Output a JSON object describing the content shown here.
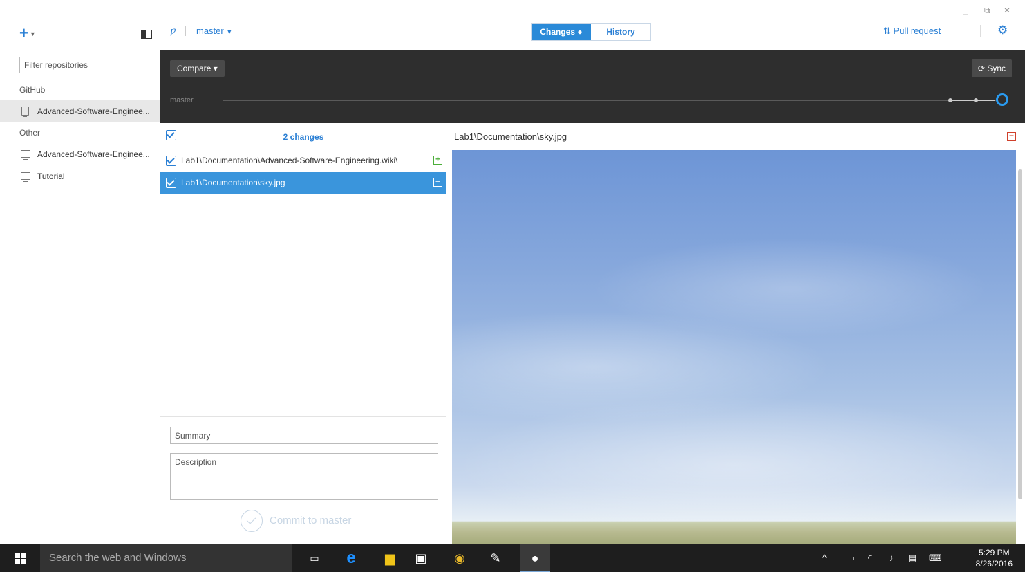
{
  "window": {
    "minimize_glyph": "_",
    "restore_glyph": "⧉",
    "close_glyph": "✕"
  },
  "sidebar": {
    "add_glyph": "+",
    "filter_placeholder": "Filter repositories",
    "section_github": "GitHub",
    "section_other": "Other",
    "github_repos": [
      {
        "label": "Advanced-Software-Enginee...",
        "icon": "repo-icon",
        "selected": true
      }
    ],
    "other_repos": [
      {
        "label": "Advanced-Software-Enginee...",
        "icon": "computer-icon"
      },
      {
        "label": "Tutorial",
        "icon": "computer-icon"
      }
    ]
  },
  "header": {
    "branch": "master",
    "tabs": [
      {
        "label": "Changes ●",
        "active": true
      },
      {
        "label": "History",
        "active": false
      }
    ],
    "pull_request": "Pull request",
    "settings_icon": "gear-icon"
  },
  "compare": {
    "button": "Compare ▾",
    "sync": "Sync",
    "timeline_branch": "master"
  },
  "changes": {
    "count_label": "2 changes",
    "files": [
      {
        "path": "Lab1\\Documentation\\Advanced-Software-Engineering.wiki\\",
        "status": "added",
        "badge": "+",
        "selected": false
      },
      {
        "path": "Lab1\\Documentation\\sky.jpg",
        "status": "modified",
        "badge": "−",
        "selected": true
      }
    ],
    "summary_placeholder": "Summary",
    "description_placeholder": "Description",
    "commit_label": "Commit to master"
  },
  "preview": {
    "path_prefix": "Lab1\\Documentation\\",
    "path_file": "sky.jpg",
    "badge": "−"
  },
  "taskbar": {
    "search_placeholder": "Search the web and Windows",
    "time": "5:29 PM",
    "date": "8/26/2016"
  },
  "colors": {
    "accent": "#2a7fd4",
    "selected_row": "#3a95dc",
    "dark_bar": "#2e2e2e",
    "added": "#4cae3a",
    "deleted": "#d0402b"
  }
}
